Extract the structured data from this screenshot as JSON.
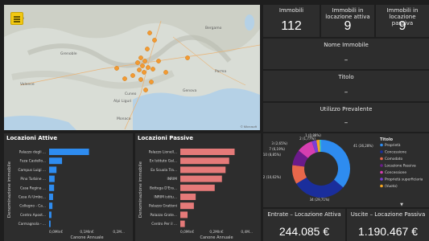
{
  "kpis": [
    {
      "title": "Immobili",
      "value": "112"
    },
    {
      "title": "Immobili in locazione attiva",
      "value": "9"
    },
    {
      "title": "Immobili in locazione passiva",
      "value": "9"
    }
  ],
  "slicers": [
    {
      "title": "Nome Immobile",
      "value": "–"
    },
    {
      "title": "Titolo",
      "value": "–"
    },
    {
      "title": "Utilizzo Prevalente",
      "value": "–"
    }
  ],
  "map": {
    "labels": [
      "Varese",
      "Genova",
      "Parma",
      "Monaco",
      "Valence",
      "Grenoble",
      "Cuneo",
      "Alpi Liguri",
      "Bergamo"
    ],
    "copyright": "© Microsoft"
  },
  "money": {
    "attiva": {
      "title": "Entrate – Locazione Attiva",
      "value": "244.085 €"
    },
    "passiva": {
      "title": "Uscite – Locazione Passiva",
      "value": "1.190.467 €"
    }
  },
  "chart_data": [
    {
      "type": "bar",
      "title": "Locazioni Attive",
      "categories": [
        "Palazzo degli ...",
        "Fuza Castello...",
        "Campus Luigi ...",
        "Pino Turbine ...",
        "Casa Regina ...",
        "Casa Ai Umbe...",
        "Collegno - Ca...",
        "Centro Apost...",
        "Carmagnola - ..."
      ],
      "values": [
        0.1055,
        0.0342,
        0.0195,
        0.0146,
        0.0132,
        0.0105,
        0.0088,
        0.0062,
        0.004
      ],
      "xlabel": "Canone Annuale",
      "ylabel": "Denominazione immobile",
      "xticks": [
        "0,0Mln€",
        "0,1Mln€",
        "0,2M..."
      ],
      "xlim": [
        0,
        0.2
      ],
      "color": "#2e8cf0"
    },
    {
      "type": "bar",
      "title": "Locazioni Passive",
      "categories": [
        "Palazzo Lionell...",
        "Ex Istituto Gal...",
        "Ex Scuola Tra...",
        "INRIM",
        "Bottega D'Era...",
        "INRIM istitu...",
        "Palazzo Grattoni",
        "Palazzo Grate...",
        "Centro Per il ..."
      ],
      "values": [
        0.3,
        0.27,
        0.25,
        0.23,
        0.19,
        0.085,
        0.075,
        0.04,
        0.025
      ],
      "xlabel": "Canone Annuale",
      "ylabel": "Denominazione immobile",
      "xticks": [
        "0,0Mln€",
        "0,2Mln€",
        "0,4M..."
      ],
      "xlim": [
        0,
        0.4
      ],
      "color": "#e57a79"
    },
    {
      "type": "pie",
      "title": "Titolo",
      "donut": true,
      "slices": [
        {
          "label": "Proprietà",
          "value": 41,
          "pct": "36,28%",
          "color": "#2e8cf0"
        },
        {
          "label": "Concessione",
          "value": 34,
          "pct": "29,71%",
          "color": "#1a2e9c"
        },
        {
          "label": "Comodato",
          "value": 12,
          "pct": "10,62%",
          "color": "#e8674b"
        },
        {
          "label": "Locazione Passiva",
          "value": 10,
          "pct": "8,85%",
          "color": "#6b1b8a"
        },
        {
          "label": "Concessione",
          "value": 10,
          "pct": "8,85%",
          "color": "#d63eb0"
        },
        {
          "label": "Proprietà superficiaria",
          "value": 3,
          "pct": "2,65%",
          "color": "#7a3fd6"
        },
        {
          "label": "(Vuoto)",
          "value": 2,
          "pct": "1,77%",
          "color": "#f5a623"
        },
        {
          "label": "",
          "value": 1,
          "pct": "0,88%",
          "color": "#2bbcd6"
        }
      ],
      "data_labels": [
        "41 (36,28%)",
        "34 (29,71%)",
        "12 (10,62%)",
        "10 (8,85%)",
        "10 (8,85%)",
        "7 (6,19%)",
        "3 (2,65%)",
        "2 (1,77%)",
        "1 (0,88%)"
      ]
    }
  ]
}
